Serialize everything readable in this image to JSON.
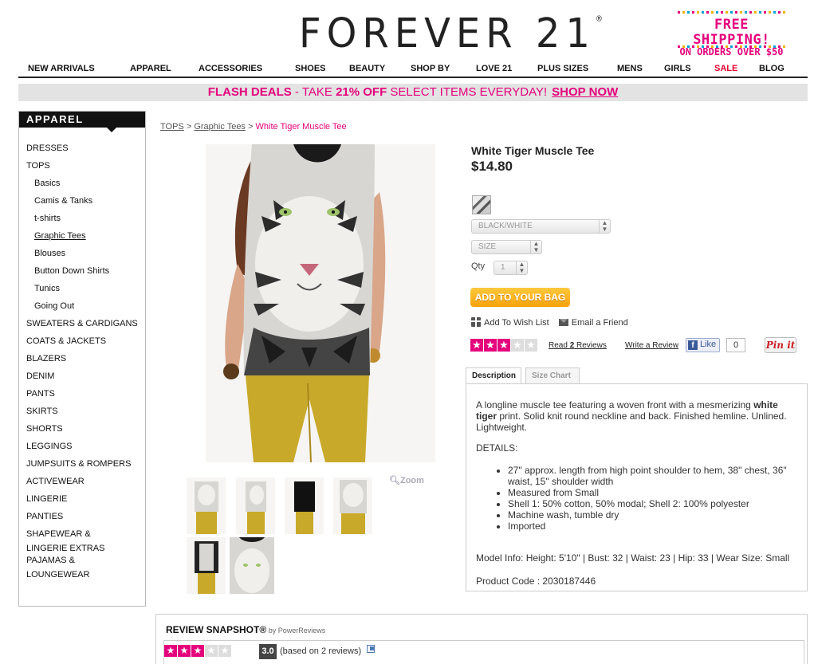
{
  "header": {
    "logo": "FOREVER 21",
    "logo_mark": "®",
    "promo_top": "FREE SHIPPING!",
    "promo_bottom": "ON ORDERS OVER $50"
  },
  "nav": [
    "NEW ARRIVALS",
    "APPAREL",
    "ACCESSORIES",
    "SHOES",
    "BEAUTY",
    "SHOP BY",
    "LOVE 21",
    "PLUS SIZES",
    "MENS",
    "GIRLS",
    "SALE",
    "BLOG"
  ],
  "flash": {
    "lead": "FLASH DEALS",
    "dash": " - TAKE ",
    "pct": "21% OFF",
    "rest": " SELECT ITEMS EVERYDAY!",
    "cta": "SHOP NOW"
  },
  "sidebar": {
    "title": "APPAREL",
    "items": [
      "DRESSES",
      "TOPS",
      "Basics",
      "Camis & Tanks",
      "t-shirts",
      "Graphic Tees",
      "Blouses",
      "Button Down Shirts",
      "Tunics",
      "Going Out",
      "SWEATERS & CARDIGANS",
      "COATS & JACKETS",
      "BLAZERS",
      "DENIM",
      "PANTS",
      "SKIRTS",
      "SHORTS",
      "LEGGINGS",
      "JUMPSUITS & ROMPERS",
      "ACTIVEWEAR",
      "LINGERIE",
      "PANTIES",
      "SHAPEWEAR & LINGERIE EXTRAS",
      "PAJAMAS & LOUNGEWEAR"
    ]
  },
  "breadcrumb": {
    "c1": "TOPS",
    "sep": ">",
    "c2": "Graphic Tees",
    "current": "White Tiger Muscle Tee"
  },
  "product": {
    "name": "White Tiger Muscle Tee",
    "price": "$14.80",
    "color_select": "BLACK/WHITE",
    "size_select": "SIZE",
    "qty_label": "Qty",
    "qty_value": "1",
    "add_to_bag": "ADD TO YOUR BAG",
    "wish_list": "Add To Wish List",
    "email_friend": "Email a Friend",
    "rating": 3,
    "rating_max": 5,
    "read_pre": "Read ",
    "read_count": "2",
    "read_post": " Reviews",
    "write_review": "Write a Review",
    "fb_like": "Like",
    "fb_count": "0",
    "pin_it": "Pin it",
    "zoom": "Zoom"
  },
  "tabs": [
    "Description",
    "Size Chart"
  ],
  "description": {
    "intro_a": "A longline muscle tee featuring a woven front with a mesmerizing ",
    "intro_b": "white tiger",
    "intro_c": " print. Solid knit round neckline and back. Finished hemline. Unlined. Lightweight.",
    "details_label": "DETAILS:",
    "details": [
      "27\" approx. length from high point shoulder to hem, 38\" chest, 36\" waist, 15\" shoulder width",
      "Measured from Small",
      "Shell 1: 50% cotton, 50% modal; Shell 2: 100% polyester",
      "Machine wash, tumble dry",
      "Imported"
    ],
    "model_info": "Model Info: Height: 5'10\" | Bust: 32 | Waist: 23 | Hip: 33 | Wear Size: Small",
    "product_code": "Product Code : 2030187446"
  },
  "review_snapshot": {
    "title": "REVIEW SNAPSHOT®",
    "by": " by PowerReviews",
    "score": "3.0",
    "based": "(based on 2 reviews)",
    "rating": 3
  },
  "colors": {
    "brand_pink": "#e4007c",
    "sale_red": "#e4002b",
    "cta_orange": "#f6a20a",
    "pants_yellow": "#c9a92a"
  }
}
